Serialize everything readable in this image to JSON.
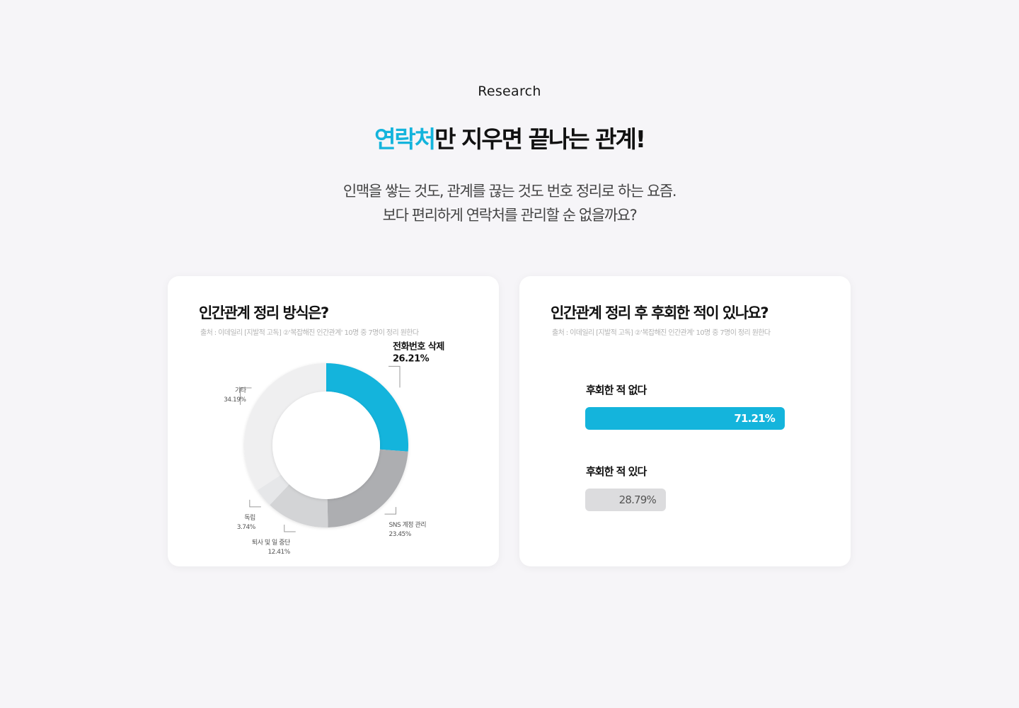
{
  "header": {
    "eyebrow": "Research",
    "headline_accent": "연락처",
    "headline_rest": "만 지우면 끝나는 관계!",
    "lead_line1": "인맥을 쌓는 것도, 관계를 끊는 것도 번호 정리로 하는 요즘.",
    "lead_line2": "보다 편리하게 연락처를 관리할 순 없을까요?"
  },
  "colors": {
    "accent": "#14b4dc",
    "gray_dark": "#adaeb1",
    "gray_mid": "#d3d4d6",
    "gray_light": "#e6e7e9",
    "gray_lightest": "#efeff0",
    "bar_gray": "#dcdcde"
  },
  "cards": {
    "left": {
      "title": "인간관계 정리 방식은?",
      "source": "출처 : 이데일리 [지발적 고독] ②'복잡해진 인간관계' 10명 중 7명이 정리 원한다"
    },
    "right": {
      "title": "인간관계 정리 후 후회한 적이 있나요?",
      "source": "출처 : 이데일리 [지발적 고독] ②'복잡해진 인간관계' 10명 중 7명이 정리 원한다"
    }
  },
  "chart_data": [
    {
      "type": "pie",
      "title": "인간관계 정리 방식은?",
      "categories": [
        "전화번호 삭제",
        "SNS 계정 관리",
        "퇴사 및 일 중단",
        "독립",
        "기타"
      ],
      "values": [
        26.21,
        23.45,
        12.41,
        3.74,
        34.19
      ],
      "labels": [
        "26.21%",
        "23.45%",
        "12.41%",
        "3.74%",
        "34.19%"
      ],
      "colors": [
        "#14b4dc",
        "#adaeb1",
        "#d3d4d6",
        "#e6e7e9",
        "#efeff0"
      ]
    },
    {
      "type": "bar",
      "title": "인간관계 정리 후 후회한 적이 있나요?",
      "categories": [
        "후회한 적 없다",
        "후회한 적 있다"
      ],
      "values": [
        71.21,
        28.79
      ],
      "labels": [
        "71.21%",
        "28.79%"
      ],
      "colors": [
        "#14b4dc",
        "#dcdcde"
      ]
    }
  ]
}
